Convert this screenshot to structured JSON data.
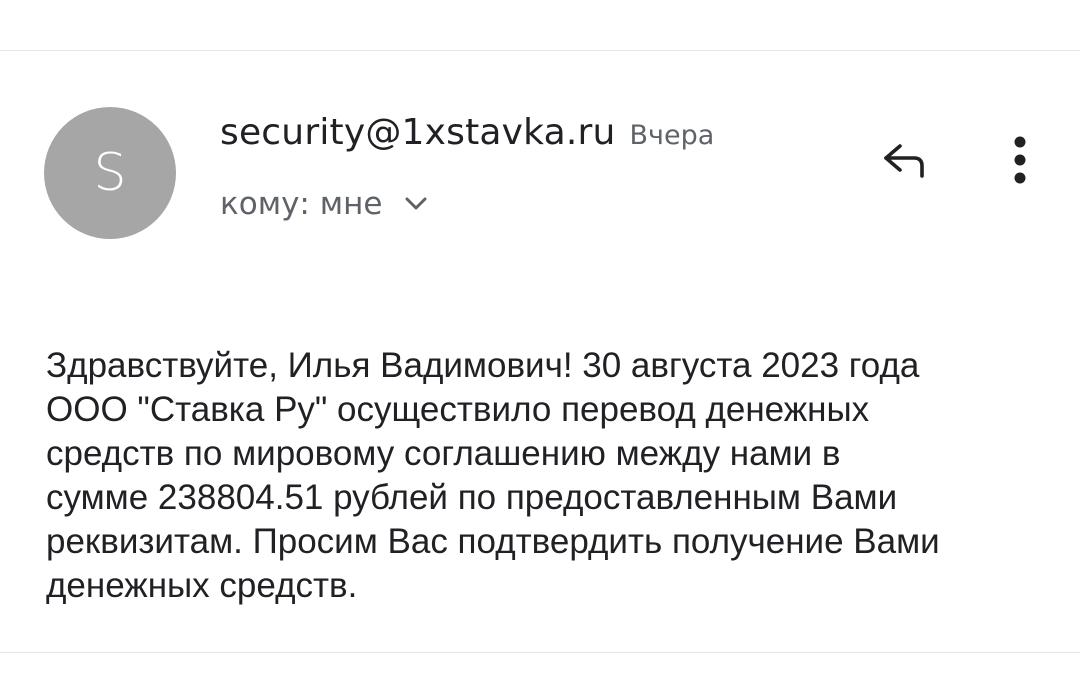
{
  "message": {
    "sender_initial": "S",
    "sender": "security@1xstavka.ru",
    "date": "Вчера",
    "recipient": "кому: мне",
    "body": "Здравствуйте, Илья Вадимович! 30 августа 2023 года\nООО \"Ставка Ру\" осуществило перевод денежных\nсредств по мировому соглашению между нами в\nсумме 238804.51 рублей по предоставленным Вами\nреквизитам. Просим Вас подтвердить получение Вами\nденежных средств."
  },
  "icons": {
    "recipient_toggle": "chevron-down-icon",
    "reply": "reply-icon",
    "more": "more-vert-icon"
  },
  "colors": {
    "avatar_bg": "#a6a6a6",
    "secondary_text": "#5f6368",
    "primary_text": "#202124"
  }
}
